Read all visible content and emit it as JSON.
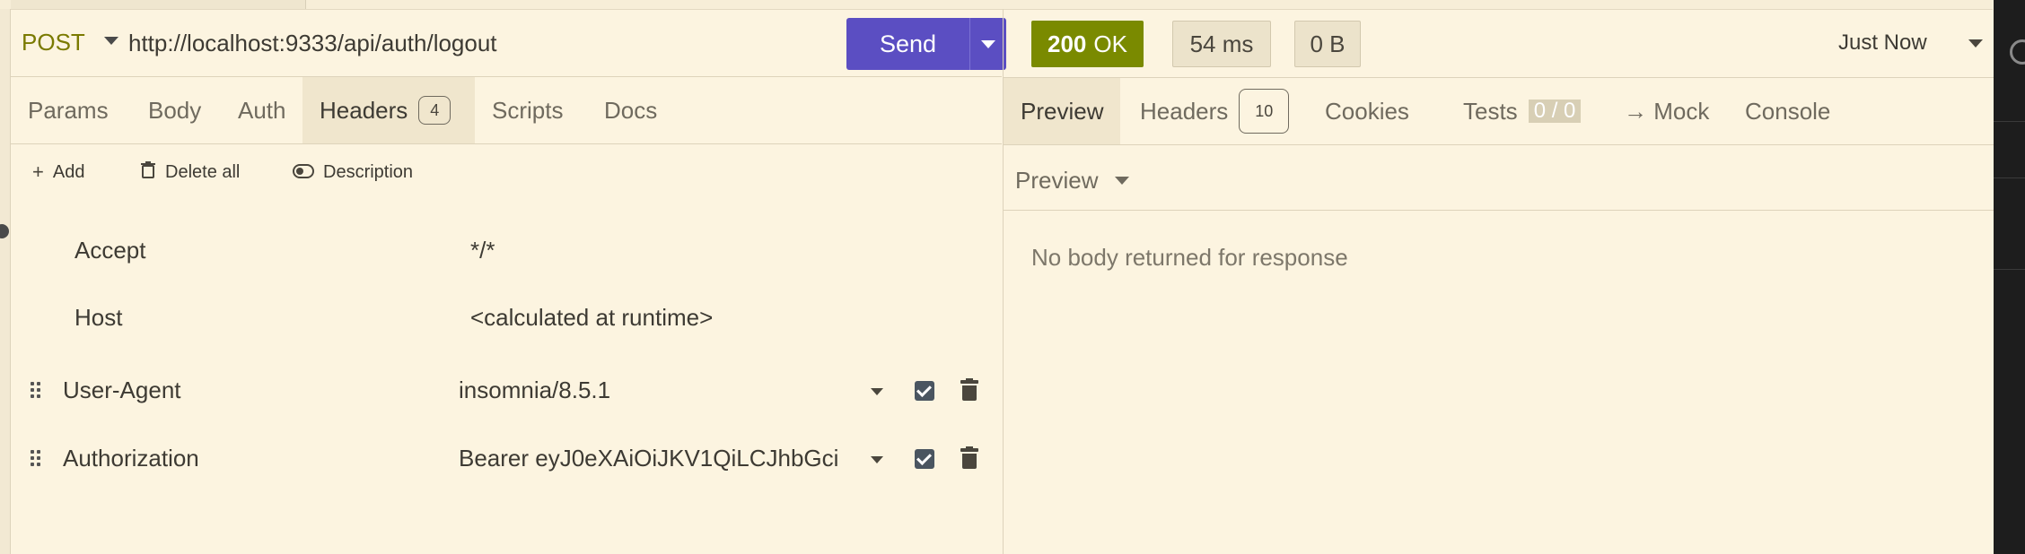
{
  "request": {
    "method": "POST",
    "url": "http://localhost:9333/api/auth/logout",
    "send_label": "Send"
  },
  "request_tabs": [
    {
      "label": "Params"
    },
    {
      "label": "Body"
    },
    {
      "label": "Auth"
    },
    {
      "label": "Headers",
      "badge": "4"
    },
    {
      "label": "Scripts"
    },
    {
      "label": "Docs"
    }
  ],
  "header_actions": {
    "add": "Add",
    "delete_all": "Delete all",
    "description": "Description"
  },
  "headers": [
    {
      "name": "Accept",
      "value": "*/*"
    },
    {
      "name": "Host",
      "value": "<calculated at runtime>"
    },
    {
      "name": "User-Agent",
      "value": "insomnia/8.5.1",
      "enabled": true
    },
    {
      "name": "Authorization",
      "value": "Bearer eyJ0eXAiOiJKV1QiLCJhbGci",
      "enabled": true
    }
  ],
  "response": {
    "status_code": "200",
    "status_text": "OK",
    "time": "54 ms",
    "size": "0 B",
    "history_label": "Just Now",
    "status_color": "#7a8a00"
  },
  "response_tabs": [
    {
      "label": "Preview"
    },
    {
      "label": "Headers",
      "badge": "10"
    },
    {
      "label": "Cookies"
    },
    {
      "label": "Tests",
      "count": "0 / 0"
    },
    {
      "label": "→ Mock"
    },
    {
      "label": "Console"
    }
  ],
  "preview": {
    "mode_label": "Preview",
    "empty_message": "No body returned for response"
  },
  "colors": {
    "background": "#fcf4e0",
    "accent": "#5b4ec2",
    "method": "#7a7a00"
  },
  "icons": {
    "add": "plus-icon",
    "delete_all": "trash-icon",
    "description": "toggle-icon",
    "row_drag": "drag-handle-icon",
    "row_enabled": "checkbox-icon",
    "row_delete": "trash-icon"
  }
}
